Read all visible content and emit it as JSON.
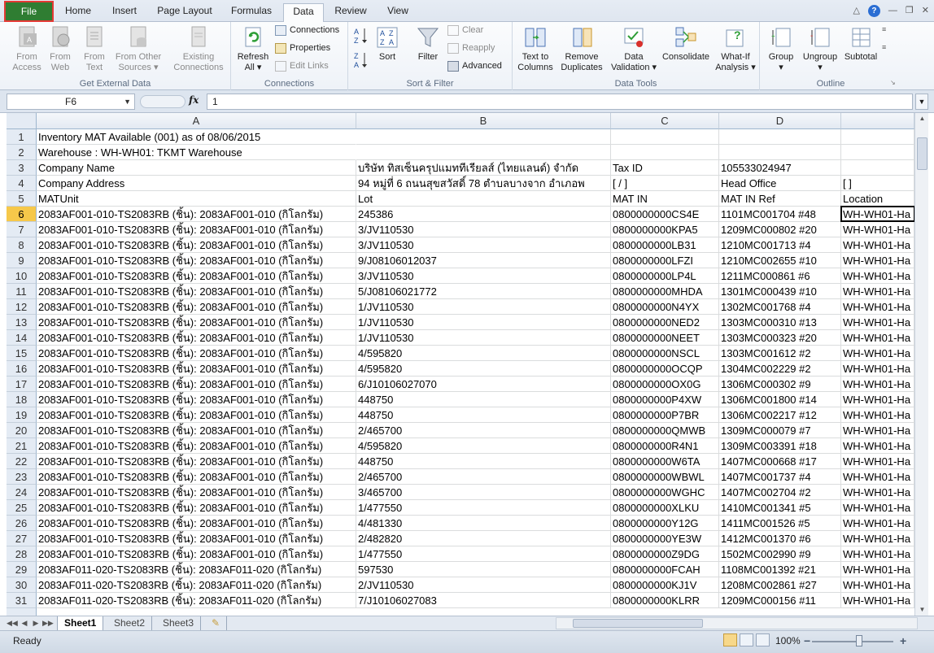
{
  "tabs": {
    "file": "File",
    "home": "Home",
    "insert": "Insert",
    "page_layout": "Page Layout",
    "formulas": "Formulas",
    "data": "Data",
    "review": "Review",
    "view": "View"
  },
  "ribbon": {
    "get_external": {
      "label": "Get External Data",
      "from_access": [
        "From",
        "Access"
      ],
      "from_web": [
        "From",
        "Web"
      ],
      "from_text": [
        "From",
        "Text"
      ],
      "from_other": [
        "From Other",
        "Sources ▾"
      ],
      "existing": [
        "Existing",
        "Connections"
      ]
    },
    "connections": {
      "label": "Connections",
      "refresh": [
        "Refresh",
        "All ▾"
      ],
      "connections": "Connections",
      "properties": "Properties",
      "edit_links": "Edit Links"
    },
    "sort_filter": {
      "label": "Sort & Filter",
      "sort": "Sort",
      "filter": "Filter",
      "clear": "Clear",
      "reapply": "Reapply",
      "advanced": "Advanced"
    },
    "data_tools": {
      "label": "Data Tools",
      "text_to_columns": [
        "Text to",
        "Columns"
      ],
      "remove_duplicates": [
        "Remove",
        "Duplicates"
      ],
      "data_validation": [
        "Data",
        "Validation ▾"
      ],
      "consolidate": "Consolidate",
      "what_if": [
        "What-If",
        "Analysis ▾"
      ]
    },
    "outline": {
      "label": "Outline",
      "group": [
        "Group",
        "▾"
      ],
      "ungroup": [
        "Ungroup",
        "▾"
      ],
      "subtotal": "Subtotal"
    }
  },
  "formula_bar": {
    "name_box": "F6",
    "fx": "fx",
    "value": "1"
  },
  "columns": [
    "A",
    "B",
    "C",
    "D"
  ],
  "rows": [
    {
      "n": "1",
      "a": "Inventory MAT Available (001) as of 08/06/2015",
      "b": "",
      "c": "",
      "d": "",
      "e": ""
    },
    {
      "n": "2",
      "a": "Warehouse : WH-WH01: TKMT Warehouse",
      "b": "",
      "c": "",
      "d": "",
      "e": ""
    },
    {
      "n": "3",
      "a": "Company Name",
      "b": "บริษัท ทิสเซ็นครุปแมททีเรียลส์ (ไทยแลนด์) จำกัด",
      "c": "Tax ID",
      "d": "105533024947",
      "e": ""
    },
    {
      "n": "4",
      "a": "Company Address",
      "b": "94 หมู่ที่ 6 ถนนสุขสวัสดิ์ 78 ตำบลบางจาก อำเภอพ",
      "c": "[ / ]",
      "d": "Head Office",
      "e": "[    ]"
    },
    {
      "n": "5",
      "a": "MATUnit",
      "b": "Lot",
      "c": "MAT IN",
      "d": "MAT IN Ref",
      "e": "Location"
    },
    {
      "n": "6",
      "a": "2083AF001-010-TS2083RB (ชิ้น): 2083AF001-010 (กิโลกรัม)",
      "b": "245386",
      "c": "0800000000CS4E",
      "d": "1101MC001704 #48",
      "e": "WH-WH01-Ha"
    },
    {
      "n": "7",
      "a": "2083AF001-010-TS2083RB (ชิ้น): 2083AF001-010 (กิโลกรัม)",
      "b": "3/JV110530",
      "c": "0800000000KPA5",
      "d": "1209MC000802 #20",
      "e": "WH-WH01-Ha"
    },
    {
      "n": "8",
      "a": "2083AF001-010-TS2083RB (ชิ้น): 2083AF001-010 (กิโลกรัม)",
      "b": "3/JV110530",
      "c": "0800000000LB31",
      "d": "1210MC001713 #4",
      "e": "WH-WH01-Ha"
    },
    {
      "n": "9",
      "a": "2083AF001-010-TS2083RB (ชิ้น): 2083AF001-010 (กิโลกรัม)",
      "b": "9/J08106012037",
      "c": "0800000000LFZI",
      "d": "1210MC002655 #10",
      "e": "WH-WH01-Ha"
    },
    {
      "n": "10",
      "a": "2083AF001-010-TS2083RB (ชิ้น): 2083AF001-010 (กิโลกรัม)",
      "b": "3/JV110530",
      "c": "0800000000LP4L",
      "d": "1211MC000861 #6",
      "e": "WH-WH01-Ha"
    },
    {
      "n": "11",
      "a": "2083AF001-010-TS2083RB (ชิ้น): 2083AF001-010 (กิโลกรัม)",
      "b": "5/J08106021772",
      "c": "0800000000MHDA",
      "d": "1301MC000439 #10",
      "e": "WH-WH01-Ha"
    },
    {
      "n": "12",
      "a": "2083AF001-010-TS2083RB (ชิ้น): 2083AF001-010 (กิโลกรัม)",
      "b": "1/JV110530",
      "c": "0800000000N4YX",
      "d": "1302MC001768 #4",
      "e": "WH-WH01-Ha"
    },
    {
      "n": "13",
      "a": "2083AF001-010-TS2083RB (ชิ้น): 2083AF001-010 (กิโลกรัม)",
      "b": "1/JV110530",
      "c": "0800000000NED2",
      "d": "1303MC000310 #13",
      "e": "WH-WH01-Ha"
    },
    {
      "n": "14",
      "a": "2083AF001-010-TS2083RB (ชิ้น): 2083AF001-010 (กิโลกรัม)",
      "b": "1/JV110530",
      "c": "0800000000NEET",
      "d": "1303MC000323 #20",
      "e": "WH-WH01-Ha"
    },
    {
      "n": "15",
      "a": "2083AF001-010-TS2083RB (ชิ้น): 2083AF001-010 (กิโลกรัม)",
      "b": "4/595820",
      "c": "0800000000NSCL",
      "d": "1303MC001612 #2",
      "e": "WH-WH01-Ha"
    },
    {
      "n": "16",
      "a": "2083AF001-010-TS2083RB (ชิ้น): 2083AF001-010 (กิโลกรัม)",
      "b": "4/595820",
      "c": "0800000000OCQP",
      "d": "1304MC002229 #2",
      "e": "WH-WH01-Ha"
    },
    {
      "n": "17",
      "a": "2083AF001-010-TS2083RB (ชิ้น): 2083AF001-010 (กิโลกรัม)",
      "b": "6/J10106027070",
      "c": "0800000000OX0G",
      "d": "1306MC000302 #9",
      "e": "WH-WH01-Ha"
    },
    {
      "n": "18",
      "a": "2083AF001-010-TS2083RB (ชิ้น): 2083AF001-010 (กิโลกรัม)",
      "b": "448750",
      "c": "0800000000P4XW",
      "d": "1306MC001800 #14",
      "e": "WH-WH01-Ha"
    },
    {
      "n": "19",
      "a": "2083AF001-010-TS2083RB (ชิ้น): 2083AF001-010 (กิโลกรัม)",
      "b": "448750",
      "c": "0800000000P7BR",
      "d": "1306MC002217 #12",
      "e": "WH-WH01-Ha"
    },
    {
      "n": "20",
      "a": "2083AF001-010-TS2083RB (ชิ้น): 2083AF001-010 (กิโลกรัม)",
      "b": "2/465700",
      "c": "0800000000QMWB",
      "d": "1309MC000079 #7",
      "e": "WH-WH01-Ha"
    },
    {
      "n": "21",
      "a": "2083AF001-010-TS2083RB (ชิ้น): 2083AF001-010 (กิโลกรัม)",
      "b": "4/595820",
      "c": "0800000000R4N1",
      "d": "1309MC003391 #18",
      "e": "WH-WH01-Ha"
    },
    {
      "n": "22",
      "a": "2083AF001-010-TS2083RB (ชิ้น): 2083AF001-010 (กิโลกรัม)",
      "b": "448750",
      "c": "0800000000W6TA",
      "d": "1407MC000668 #17",
      "e": "WH-WH01-Ha"
    },
    {
      "n": "23",
      "a": "2083AF001-010-TS2083RB (ชิ้น): 2083AF001-010 (กิโลกรัม)",
      "b": "2/465700",
      "c": "0800000000WBWL",
      "d": "1407MC001737 #4",
      "e": "WH-WH01-Ha"
    },
    {
      "n": "24",
      "a": "2083AF001-010-TS2083RB (ชิ้น): 2083AF001-010 (กิโลกรัม)",
      "b": "3/465700",
      "c": "0800000000WGHC",
      "d": "1407MC002704 #2",
      "e": "WH-WH01-Ha"
    },
    {
      "n": "25",
      "a": "2083AF001-010-TS2083RB (ชิ้น): 2083AF001-010 (กิโลกรัม)",
      "b": "1/477550",
      "c": "0800000000XLKU",
      "d": "1410MC001341 #5",
      "e": "WH-WH01-Ha"
    },
    {
      "n": "26",
      "a": "2083AF001-010-TS2083RB (ชิ้น): 2083AF001-010 (กิโลกรัม)",
      "b": "4/481330",
      "c": "0800000000Y12G",
      "d": "1411MC001526 #5",
      "e": "WH-WH01-Ha"
    },
    {
      "n": "27",
      "a": "2083AF001-010-TS2083RB (ชิ้น): 2083AF001-010 (กิโลกรัม)",
      "b": "2/482820",
      "c": "0800000000YE3W",
      "d": "1412MC001370 #6",
      "e": "WH-WH01-Ha"
    },
    {
      "n": "28",
      "a": "2083AF001-010-TS2083RB (ชิ้น): 2083AF001-010 (กิโลกรัม)",
      "b": "1/477550",
      "c": "0800000000Z9DG",
      "d": "1502MC002990 #9",
      "e": "WH-WH01-Ha"
    },
    {
      "n": "29",
      "a": "2083AF011-020-TS2083RB (ชิ้น): 2083AF011-020 (กิโลกรัม)",
      "b": "597530",
      "c": "0800000000FCAH",
      "d": "1108MC001392 #21",
      "e": "WH-WH01-Ha"
    },
    {
      "n": "30",
      "a": "2083AF011-020-TS2083RB (ชิ้น): 2083AF011-020 (กิโลกรัม)",
      "b": "2/JV110530",
      "c": "0800000000KJ1V",
      "d": "1208MC002861 #27",
      "e": "WH-WH01-Ha"
    },
    {
      "n": "31",
      "a": "2083AF011-020-TS2083RB (ชิ้น): 2083AF011-020 (กิโลกรัม)",
      "b": "7/J10106027083",
      "c": "0800000000KLRR",
      "d": "1209MC000156 #11",
      "e": "WH-WH01-Ha"
    }
  ],
  "sheets": [
    "Sheet1",
    "Sheet2",
    "Sheet3"
  ],
  "status": {
    "ready": "Ready",
    "zoom": "100%"
  }
}
